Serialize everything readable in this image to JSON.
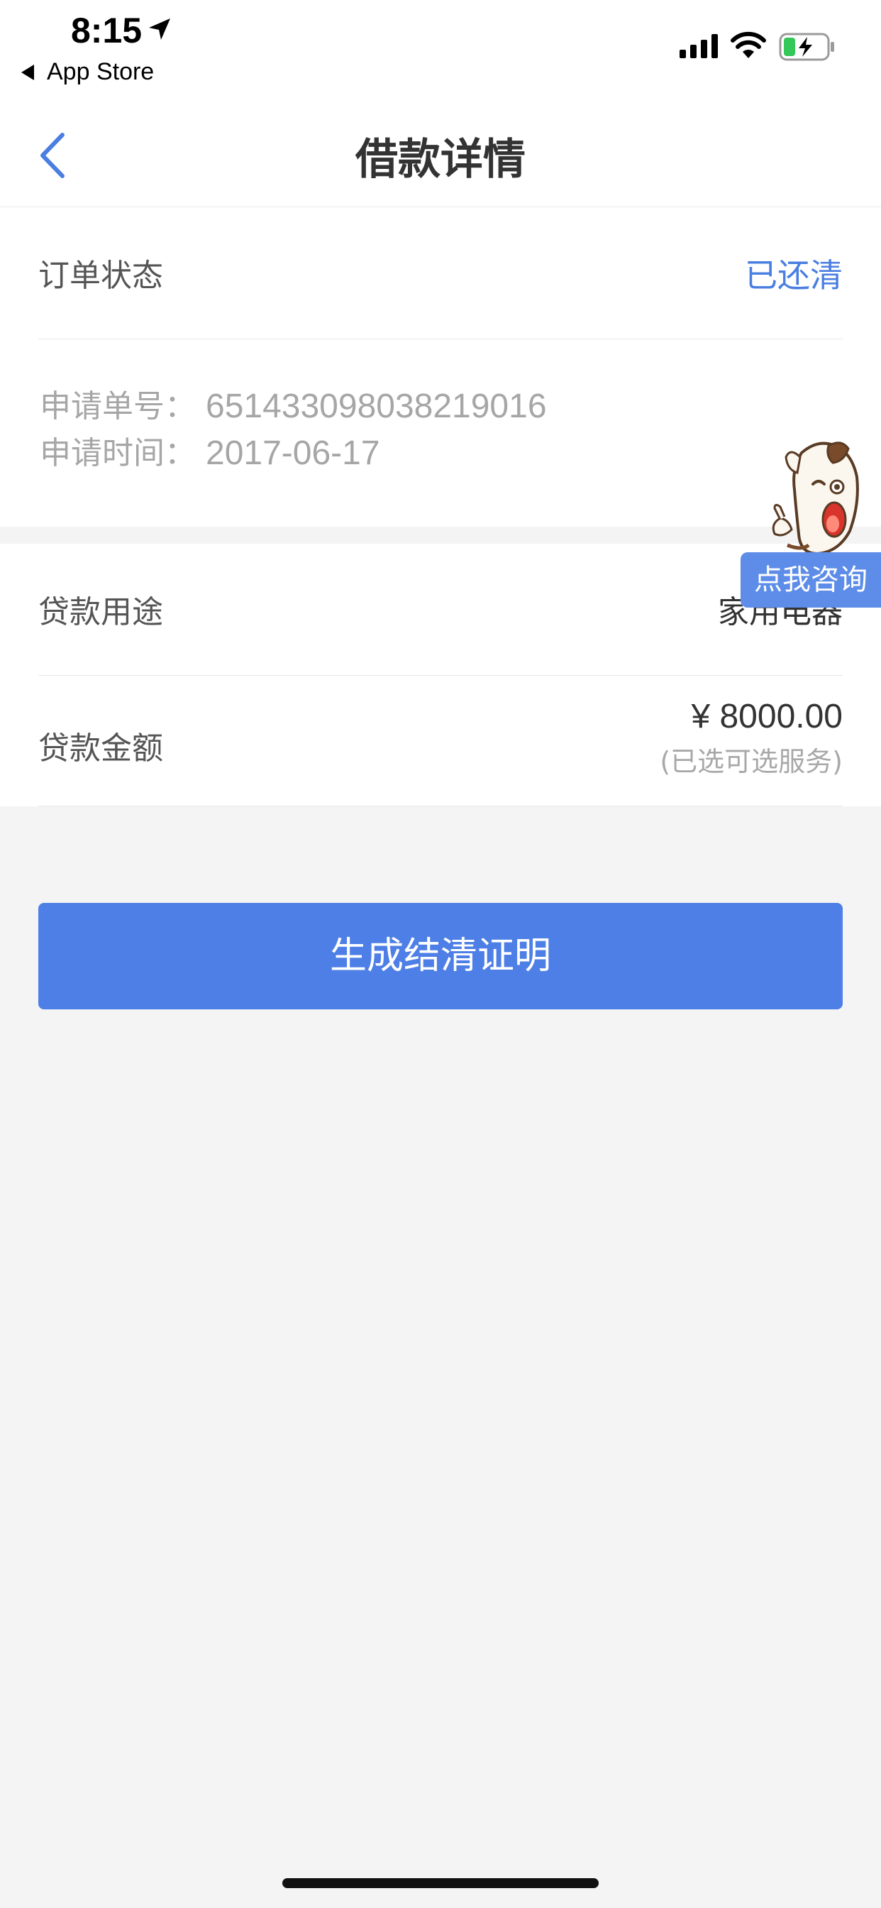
{
  "status_bar": {
    "time": "8:15",
    "back_app": "App Store",
    "icons": [
      "location-arrow-icon",
      "signal-icon",
      "wifi-icon",
      "battery-charging-icon"
    ]
  },
  "nav": {
    "title": "借款详情",
    "back_icon": "chevron-left-icon",
    "accent": "#4a7ee0"
  },
  "order": {
    "status_label": "订单状态",
    "status_value": "已还清",
    "apply_no_label": "申请单号：",
    "apply_no": "651433098038219016",
    "apply_time_label": "申请时间：",
    "apply_time": "2017-06-17"
  },
  "loan": {
    "purpose_label": "贷款用途",
    "purpose_value": "家用电器",
    "amount_label": "贷款金额",
    "amount_value": "¥ 8000.00",
    "amount_note": "(已选可选服务)"
  },
  "actions": {
    "primary_label": "生成结清证明",
    "primary_color": "#4d7fe6"
  },
  "consult": {
    "label": "点我咨询",
    "icon": "mascot-dog-icon"
  }
}
